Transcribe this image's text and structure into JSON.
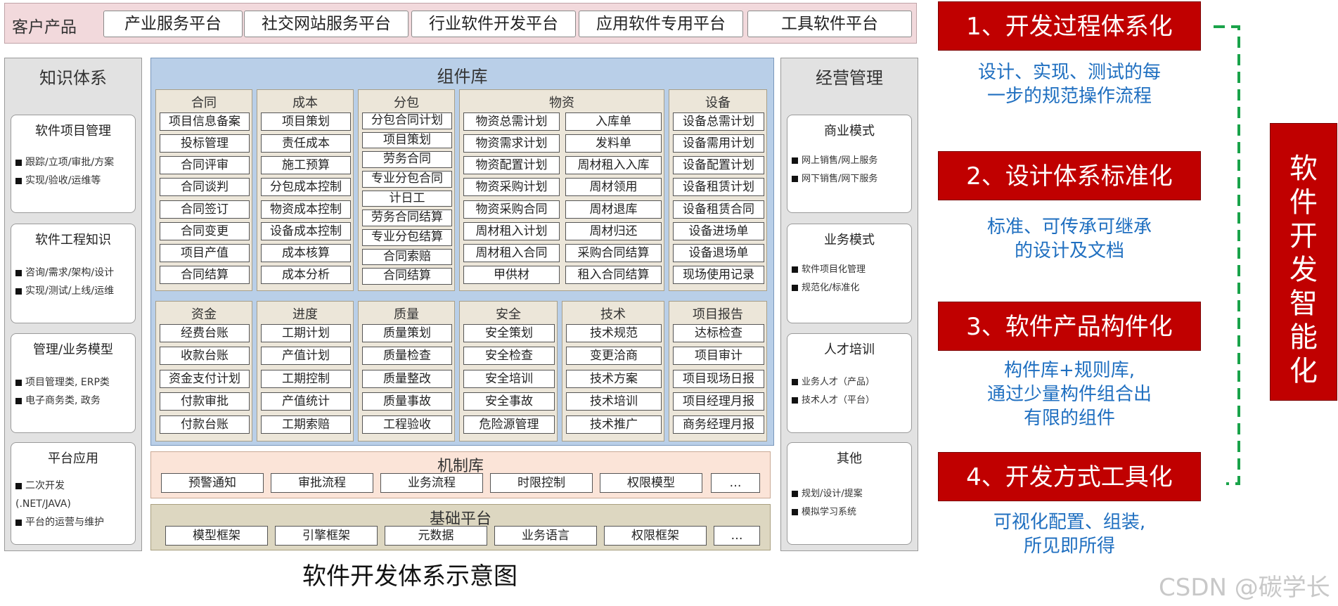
{
  "customer": {
    "label": "客户产品",
    "products": [
      "产业服务平台",
      "社交网站服务平台",
      "行业软件开发平台",
      "应用软件专用平台",
      "工具软件平台"
    ]
  },
  "knowledge": {
    "title": "知识体系",
    "cards": [
      {
        "title": "软件项目管理",
        "lines": [
          "跟踪/立项/审批/方案",
          "实现/验收/运维等"
        ]
      },
      {
        "title": "软件工程知识",
        "lines": [
          "咨询/需求/架构/设计",
          "实现/测试/上线/运维"
        ]
      },
      {
        "title": "管理/业务模型",
        "lines": [
          "项目管理类, ERP类",
          "电子商务类, 政务"
        ]
      },
      {
        "title": "平台应用",
        "lines": [
          "二次开发",
          "(.NET/JAVA)",
          "平台的运营与维护"
        ]
      }
    ]
  },
  "components": {
    "title": "组件库",
    "groups": [
      {
        "title": "合同",
        "items": [
          "项目信息备案",
          "投标管理",
          "合同评审",
          "合同谈判",
          "合同签订",
          "合同变更",
          "项目产值",
          "合同结算"
        ]
      },
      {
        "title": "成本",
        "items": [
          "项目策划",
          "责任成本",
          "施工预算",
          "分包成本控制",
          "物资成本控制",
          "设备成本控制",
          "成本核算",
          "成本分析"
        ]
      },
      {
        "title": "分包",
        "items": [
          "分包合同计划",
          "项目策划",
          "劳务合同",
          "专业分包合同",
          "计日工",
          "劳务合同结算",
          "专业分包结算",
          "合同索赔",
          "合同结算"
        ]
      },
      {
        "title": "物资",
        "items": [
          "物资总需计划",
          "入库单",
          "物资需求计划",
          "发料单",
          "物资配置计划",
          "周材租入入库",
          "物资采购计划",
          "周材领用",
          "物资采购合同",
          "周材退库",
          "周材租入计划",
          "周材归还",
          "周材租入合同",
          "采购合同结算",
          "甲供材",
          "租入合同结算"
        ]
      },
      {
        "title": "设备",
        "items": [
          "设备总需计划",
          "设备需用计划",
          "设备配置计划",
          "设备租赁计划",
          "设备租赁合同",
          "设备进场单",
          "设备退场单",
          "现场使用记录"
        ]
      },
      {
        "title": "资金",
        "items": [
          "经费台账",
          "收款台账",
          "资金支付计划",
          "付款审批",
          "付款台账"
        ]
      },
      {
        "title": "进度",
        "items": [
          "工期计划",
          "产值计划",
          "工期控制",
          "产值统计",
          "工期索赔"
        ]
      },
      {
        "title": "质量",
        "items": [
          "质量策划",
          "质量检查",
          "质量整改",
          "质量事故",
          "工程验收"
        ]
      },
      {
        "title": "安全",
        "items": [
          "安全策划",
          "安全检查",
          "安全培训",
          "安全事故",
          "危险源管理"
        ]
      },
      {
        "title": "技术",
        "items": [
          "技术规范",
          "变更洽商",
          "技术方案",
          "技术培训",
          "技术推广"
        ]
      },
      {
        "title": "项目报告",
        "items": [
          "达标检查",
          "项目审计",
          "项目现场日报",
          "项目经理月报",
          "商务经理月报"
        ]
      }
    ]
  },
  "mechanism": {
    "title": "机制库",
    "items": [
      "预警通知",
      "审批流程",
      "业务流程",
      "时限控制",
      "权限模型",
      "…"
    ]
  },
  "base": {
    "title": "基础平台",
    "items": [
      "模型框架",
      "引擎框架",
      "元数据",
      "业务语言",
      "权限框架",
      "…"
    ]
  },
  "caption": "软件开发体系示意图",
  "management": {
    "title": "经营管理",
    "cards": [
      {
        "title": "商业模式",
        "lines": [
          "网上销售/网上服务",
          "网下销售/网下服务"
        ]
      },
      {
        "title": "业务模式",
        "lines": [
          "软件项目化管理",
          "规范化/标准化"
        ]
      },
      {
        "title": "人才培训",
        "lines": [
          "业务人才（产品）",
          "技术人才（平台）"
        ]
      },
      {
        "title": "其他",
        "lines": [
          "规划/设计/提案",
          "模拟学习系统"
        ]
      }
    ]
  },
  "steps": [
    {
      "title": "1、开发过程体系化",
      "desc": [
        "设计、实现、测试的每",
        "一步的规范操作流程"
      ]
    },
    {
      "title": "2、设计体系标准化",
      "desc": [
        "标准、可传承可继承",
        "的设计及文档"
      ]
    },
    {
      "title": "3、软件产品构件化",
      "desc": [
        "构件库+规则库,",
        "通过少量构件组合出",
        "有限的组件"
      ]
    },
    {
      "title": "4、开发方式工具化",
      "desc": [
        "可视化配置、组装,",
        "所见即所得"
      ]
    }
  ],
  "goal": {
    "chars": [
      "软",
      "件",
      "开",
      "发",
      "智",
      "能",
      "化"
    ]
  },
  "watermark": "CSDN @碳学长",
  "colors": {
    "red": "#c00000",
    "blue_text": "#1f6fc0",
    "dash_green": "#1aa34a",
    "comp_lib_blue": "#b9cfe8"
  }
}
